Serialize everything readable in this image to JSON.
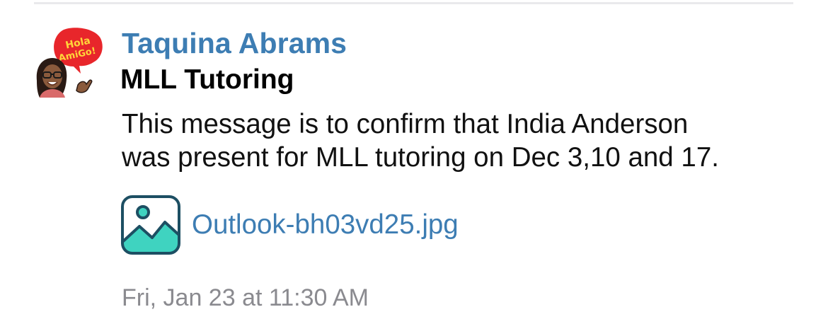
{
  "message": {
    "sender_name": "Taquina Abrams",
    "subject": "MLL Tutoring",
    "body_lines": [
      "This message is to confirm that India Anderson",
      "was present for MLL tutoring on Dec 3,10 and 17."
    ],
    "timestamp": "Fri, Jan 23 at 11:30 AM"
  },
  "avatar": {
    "icon": "bitmoji-avatar-icon",
    "bubble_text_line1": "Hola",
    "bubble_text_line2": "AmiGo!",
    "bubble_color": "#e8262b",
    "bubble_text_color": "#ffd53a"
  },
  "attachment": {
    "icon": "image-file-icon",
    "filename": "Outlook-bh03vd25.jpg",
    "icon_stroke_color": "#1d4f63",
    "icon_fill_color": "#3fd3c0"
  },
  "colors": {
    "link_blue": "#3d7db3",
    "text_black": "#111111",
    "muted_gray": "#8a8a8f"
  }
}
